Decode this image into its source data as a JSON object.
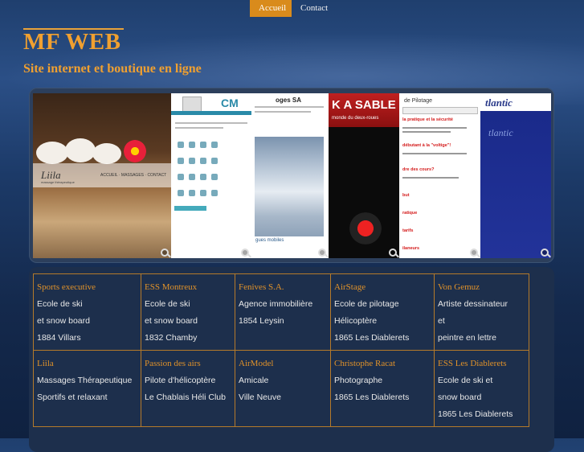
{
  "nav": {
    "items": [
      {
        "label": "Accueil",
        "active": true
      },
      {
        "label": "Contact",
        "active": false
      }
    ]
  },
  "header": {
    "title": "MF WEB",
    "subtitle": "Site internet et boutique en ligne"
  },
  "gallery": {
    "liila": {
      "logo": "Liila",
      "logo_sub": "massage thérapeutique",
      "menu": "ACCUEIL · MASSAGES · CONTACT"
    },
    "cm": {
      "logo": "CM"
    },
    "fenives": {
      "header": "oges SA",
      "caption": "gues mobiles"
    },
    "airstage": {
      "banner": "K A SABLE",
      "banner_sub": "monde du deux-roues"
    },
    "pilotage": {
      "header": "de Pilotage",
      "heading1": "la pratique et la sécurité",
      "heading2": "débutant à la \"voltige\"!",
      "heading3": "dre des cours?",
      "heading4": "but",
      "heading5": "ratique",
      "heading6": "tarifs",
      "heading7": "ilaneurs"
    },
    "atlantic": {
      "logo": "tlantic",
      "sub": "tlantic"
    },
    "icons": {
      "zoom": "zoom-magnifier-icon"
    }
  },
  "partners": {
    "rows": [
      [
        {
          "name": "Sports executive",
          "lines": [
            "Ecole de ski",
            "et snow board",
            "1884 Villars"
          ]
        },
        {
          "name": "ESS Montreux",
          "lines": [
            "Ecole de ski",
            "et snow board",
            "1832 Chamby"
          ]
        },
        {
          "name": "Fenives S.A.",
          "lines": [
            "Agence immobilière",
            "1854 Leysin"
          ]
        },
        {
          "name": "AirStage",
          "lines": [
            "Ecole de pilotage",
            "Hélicoptère",
            "1865 Les Diablerets"
          ]
        },
        {
          "name": "Von Gemuz",
          "lines": [
            "Artiste dessinateur",
            "et",
            "peintre en lettre"
          ]
        }
      ],
      [
        {
          "name": "Liila",
          "lines": [
            "Massages Thérapeutique",
            "Sportifs et relaxant"
          ]
        },
        {
          "name": "Passion des airs",
          "lines": [
            "Pilote d'hélicoptère",
            "Le Chablais Héli Club"
          ]
        },
        {
          "name": "AirModel",
          "lines": [
            "Amicale",
            "Ville Neuve"
          ]
        },
        {
          "name": "Christophe Racat",
          "lines": [
            "Photographe",
            "1865 Les Diablerets"
          ]
        },
        {
          "name": "ESS Les Diablerets",
          "lines": [
            "Ecole de ski et",
            "snow board",
            "1865 Les Diablerets"
          ]
        }
      ]
    ]
  },
  "colors": {
    "accent": "#e0922a",
    "nav_active": "#d98b1c",
    "background": "#1c3a68"
  }
}
